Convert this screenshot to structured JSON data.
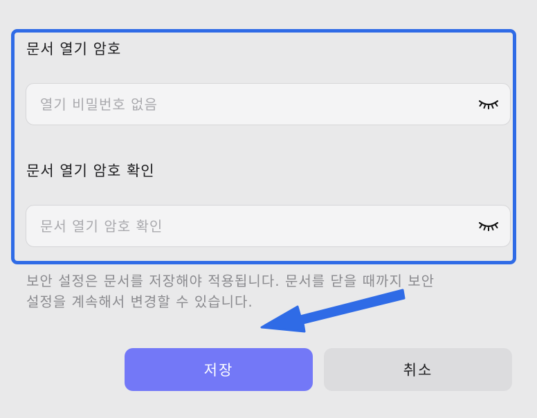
{
  "password_section": {
    "label": "문서 열기 암호",
    "placeholder": "열기 비밀번호 없음",
    "value": "",
    "visibility_icon": "eye-closed-icon"
  },
  "confirm_section": {
    "label": "문서 열기 암호 확인",
    "placeholder": "문서 열기 암호 확인",
    "value": "",
    "visibility_icon": "eye-closed-icon"
  },
  "info": {
    "line1": "보안 설정은 문서를 저장해야 적용됩니다. 문서를 닫을 때까지 보안",
    "line2": "설정을 계속해서 변경할 수 있습니다."
  },
  "buttons": {
    "save_label": "저장",
    "cancel_label": "취소"
  },
  "colors": {
    "highlight": "#2f6be6",
    "arrow": "#2f6be6",
    "save_button": "#7378f7",
    "cancel_button": "#dcdcde"
  }
}
